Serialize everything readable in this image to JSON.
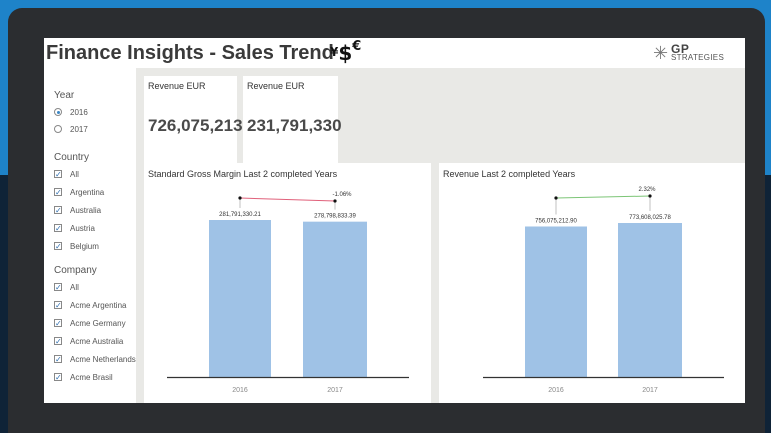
{
  "header": {
    "title": "Finance Insights - Sales Trend",
    "currency_symbols": [
      "¥",
      "$",
      "€"
    ],
    "logo_line1": "GP",
    "logo_line2": "STRATEGIES"
  },
  "filters": {
    "year_label": "Year",
    "years": [
      {
        "label": "2016",
        "selected": true
      },
      {
        "label": "2017",
        "selected": false
      }
    ],
    "country_label": "Country",
    "countries": [
      "All",
      "Argentina",
      "Australia",
      "Austria",
      "Belgium"
    ],
    "company_label": "Company",
    "companies": [
      "All",
      "Acme Argentina",
      "Acme Germany",
      "Acme Australia",
      "Acme Netherlands",
      "Acme Brasil"
    ]
  },
  "kpis": [
    {
      "title": "Revenue EUR",
      "value": "726,075,213"
    },
    {
      "title": "Revenue EUR",
      "value": "231,791,330"
    }
  ],
  "chart_data": [
    {
      "type": "bar",
      "title": "Standard Gross Margin Last 2 completed Years",
      "categories": [
        "2016",
        "2017"
      ],
      "values": [
        281791330.21,
        278798833.39
      ],
      "value_labels": [
        "281,791,330.21",
        "278,798,833.39"
      ],
      "change_label": "-1.06%",
      "change_color": "#e0607a",
      "bar_color": "#9fc2e6"
    },
    {
      "type": "bar",
      "title": "Revenue Last 2 completed Years",
      "categories": [
        "2016",
        "2017"
      ],
      "values": [
        756075212.9,
        773608025.78
      ],
      "value_labels": [
        "756,075,212.90",
        "773,608,025.78"
      ],
      "change_label": "2.32%",
      "change_color": "#7cc576",
      "bar_color": "#9fc2e6"
    }
  ]
}
